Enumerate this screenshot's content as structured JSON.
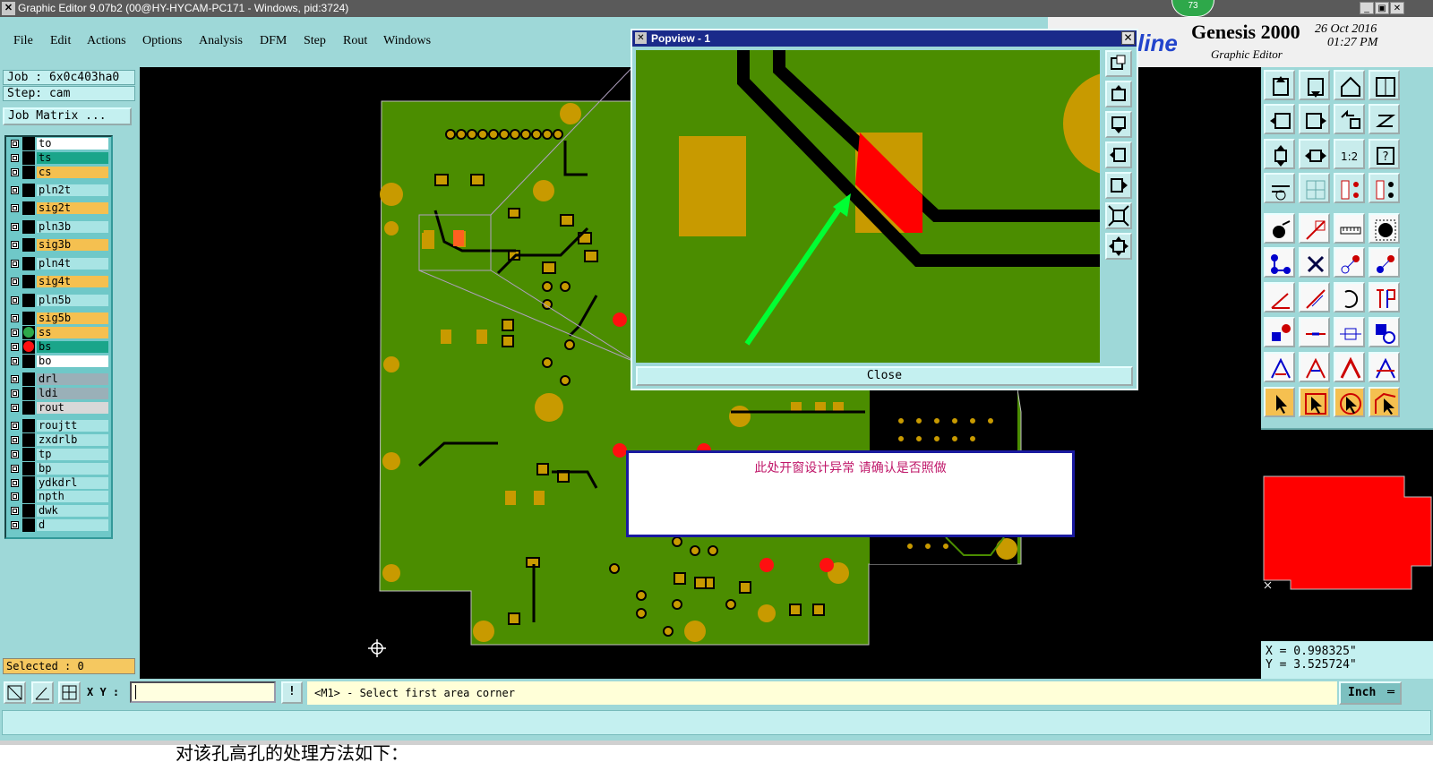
{
  "window": {
    "title": "Graphic Editor 9.07b2 (00@HY-HYCAM-PC171 - Windows, pid:3724)",
    "badge": "73"
  },
  "menu": [
    "File",
    "Edit",
    "Actions",
    "Options",
    "Analysis",
    "DFM",
    "Step",
    "Rout",
    "Windows"
  ],
  "job": {
    "job_label": "Job : 6x0c403ha0",
    "step_label": "Step: cam",
    "matrix_button": "Job Matrix ..."
  },
  "layers": [
    {
      "name": "to",
      "color": "#ffffff"
    },
    {
      "name": "ts",
      "color": "#1aa58a"
    },
    {
      "name": "cs",
      "color": "#f5c050"
    },
    {
      "name": "pln2t",
      "color": "#a8e4e4"
    },
    {
      "name": "sig2t",
      "color": "#f5c050"
    },
    {
      "name": "pln3b",
      "color": "#a8e4e4"
    },
    {
      "name": "sig3b",
      "color": "#f5c050"
    },
    {
      "name": "pln4t",
      "color": "#a8e4e4"
    },
    {
      "name": "sig4t",
      "color": "#f5c050"
    },
    {
      "name": "pln5b",
      "color": "#a8e4e4"
    },
    {
      "name": "sig5b",
      "color": "#f5c050"
    },
    {
      "name": "ss",
      "color": "#f5c050",
      "marker": "#2ea84a"
    },
    {
      "name": "bs",
      "color": "#1aa58a",
      "marker": "#ff1010"
    },
    {
      "name": "bo",
      "color": "#ffffff"
    },
    {
      "name": "drl",
      "color": "#9ab0b8"
    },
    {
      "name": "ldi",
      "color": "#9ab0b8"
    },
    {
      "name": "rout",
      "color": "#d8d8d8"
    },
    {
      "name": "roujtt",
      "color": "#a8e4e4"
    },
    {
      "name": "zxdrlb",
      "color": "#a8e4e4"
    },
    {
      "name": "tp",
      "color": "#a8e4e4"
    },
    {
      "name": "bp",
      "color": "#a8e4e4"
    },
    {
      "name": "ydkdrl",
      "color": "#a8e4e4"
    },
    {
      "name": "npth",
      "color": "#a8e4e4"
    },
    {
      "name": "dwk",
      "color": "#a8e4e4"
    },
    {
      "name": "d",
      "color": "#a8e4e4"
    }
  ],
  "selected": "Selected : 0",
  "brand": {
    "logo_text": "line",
    "product": "Genesis 2000",
    "subtitle": "Graphic Editor",
    "date": "26 Oct 2016",
    "time": "01:27 PM"
  },
  "coords": {
    "x": "X = 0.998325\"",
    "y": "Y = 3.525724\""
  },
  "bottom": {
    "xy_label": "X Y :",
    "xy_value": "",
    "status": "<M1> - Select first area corner",
    "unit": "Inch"
  },
  "popview": {
    "title": "Popview - 1",
    "close_label": "Close"
  },
  "message": "此处开窗设计异常 请确认是否照做",
  "cutoff_text": "对该孔高孔的处理方法如下：",
  "colors": {
    "board_green": "#4b8d00",
    "pad_orange": "#c89a00",
    "highlight_red": "#ff0000",
    "arrow_green": "#00ff33",
    "canvas_bg": "#000000"
  }
}
